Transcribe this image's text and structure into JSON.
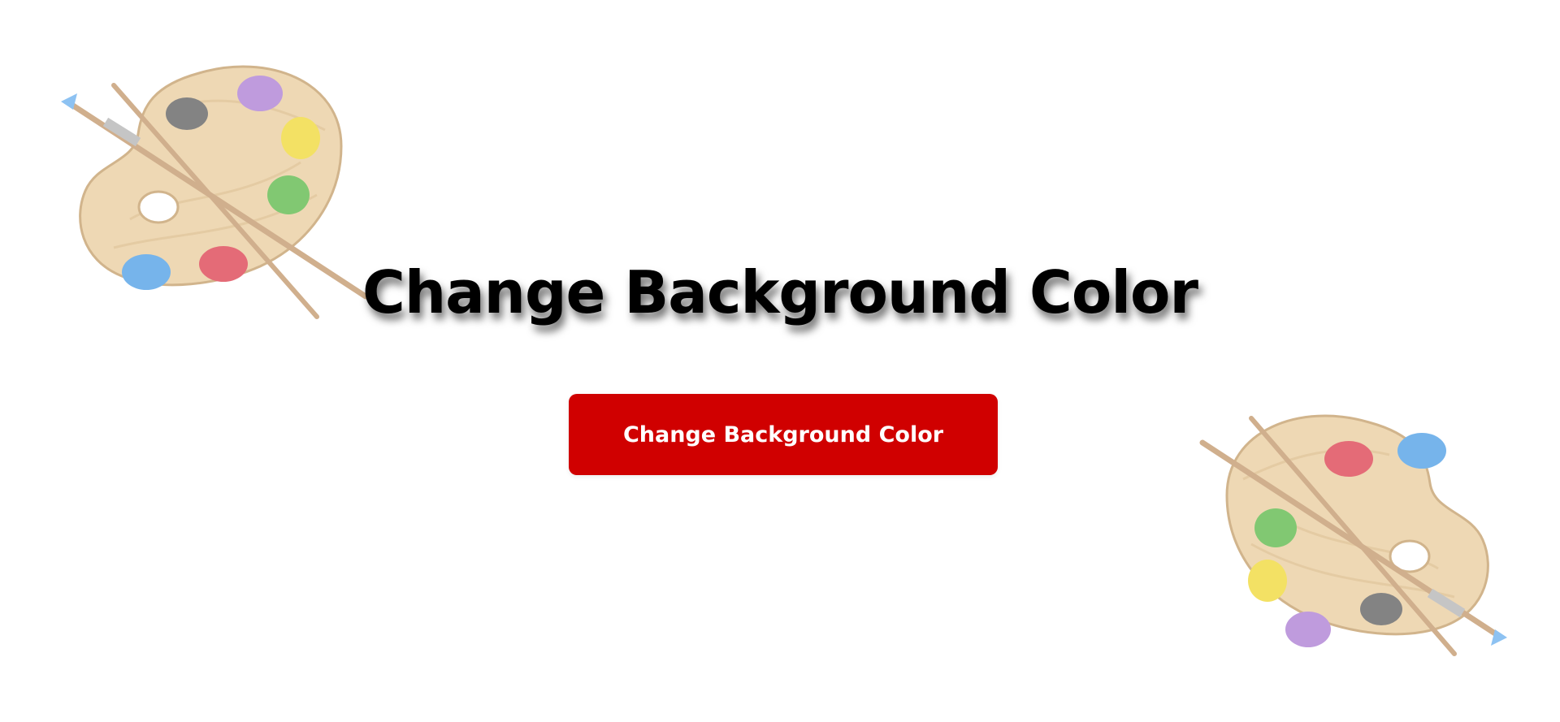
{
  "page": {
    "title": "Change Background Color",
    "button_label": "Change Background Color"
  },
  "colors": {
    "background": "#ffffff",
    "button": "#d00000",
    "button_text": "#ffffff",
    "title_text": "#000000"
  },
  "decorations": {
    "left": "paint-palette-icon",
    "right": "paint-palette-icon"
  }
}
